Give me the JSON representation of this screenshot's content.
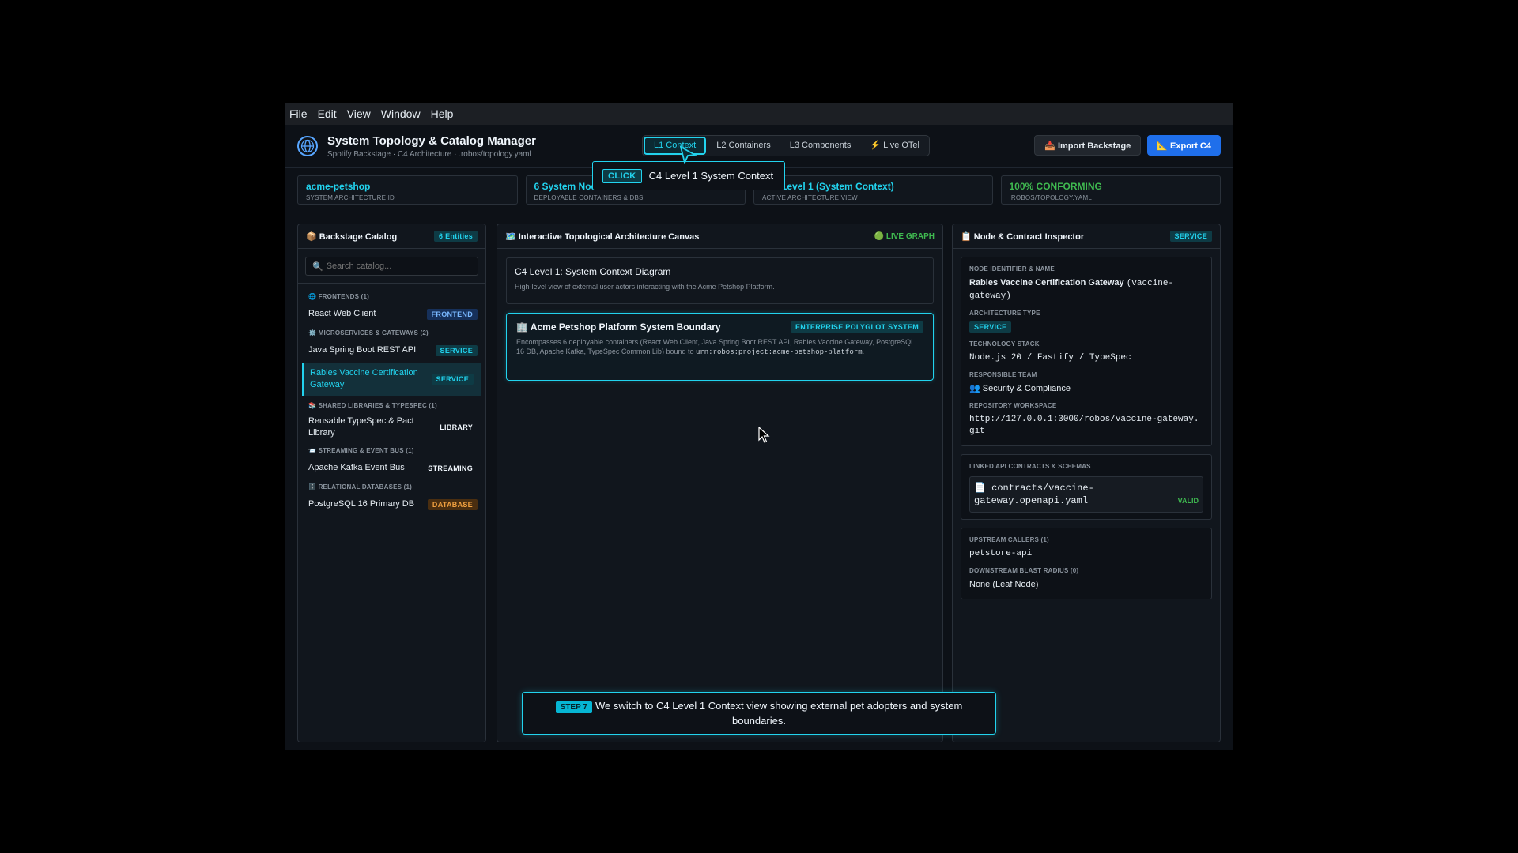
{
  "menu": [
    "File",
    "Edit",
    "View",
    "Window",
    "Help"
  ],
  "header": {
    "title": "System Topology & Catalog Manager",
    "subtitle": "Spotify Backstage · C4 Architecture · .robos/topology.yaml",
    "tabs": [
      "L1 Context",
      "L2 Containers",
      "L3 Components",
      "⚡ Live OTel"
    ],
    "import_label": "📥 Import Backstage",
    "export_label": "📐 Export C4"
  },
  "stats": [
    {
      "value": "acme-petshop",
      "label": "SYSTEM ARCHITECTURE ID"
    },
    {
      "value": "6 System Nodes",
      "label": "DEPLOYABLE CONTAINERS & DBS"
    },
    {
      "value": "Level 1 (System Context)",
      "label": "ACTIVE ARCHITECTURE VIEW"
    },
    {
      "value": "100% CONFORMING",
      "label": ".ROBOS/TOPOLOGY.YAML"
    }
  ],
  "tooltip": {
    "tag": "CLICK",
    "text": "C4 Level 1 System Context"
  },
  "catalog": {
    "title": "📦 Backstage Catalog",
    "count": "6 Entities",
    "search_placeholder": "Search catalog...",
    "groups": [
      {
        "name": "🌐 FRONTENDS (1)",
        "items": [
          {
            "name": "React Web Client",
            "kind": "FRONTEND"
          }
        ]
      },
      {
        "name": "⚙️ MICROSERVICES & GATEWAYS (2)",
        "items": [
          {
            "name": "Java Spring Boot REST API",
            "kind": "SERVICE"
          },
          {
            "name": "Rabies Vaccine Certification Gateway",
            "kind": "SERVICE"
          }
        ]
      },
      {
        "name": "📚 SHARED LIBRARIES & TYPESPEC (1)",
        "items": [
          {
            "name": "Reusable TypeSpec & Pact Library",
            "kind": "LIBRARY"
          }
        ]
      },
      {
        "name": "📨 STREAMING & EVENT BUS (1)",
        "items": [
          {
            "name": "Apache Kafka Event Bus",
            "kind": "STREAMING"
          }
        ]
      },
      {
        "name": "🗄️ RELATIONAL DATABASES (1)",
        "items": [
          {
            "name": "PostgreSQL 16 Primary DB",
            "kind": "DATABASE"
          }
        ]
      }
    ]
  },
  "canvas": {
    "title": "🗺️ Interactive Topological Architecture Canvas",
    "status": "🟢 LIVE GRAPH",
    "diagram_title": "C4 Level 1: System Context Diagram",
    "diagram_desc": "High-level view of external user actors interacting with the Acme Petshop Platform.",
    "boundary_title": "🏢 Acme Petshop Platform System Boundary",
    "boundary_badge": "ENTERPRISE POLYGLOT SYSTEM",
    "boundary_desc": "Encompasses 6 deployable containers (React Web Client, Java Spring Boot REST API, Rabies Vaccine Gateway, PostgreSQL 16 DB, Apache Kafka, TypeSpec Common Lib) bound to ",
    "boundary_urn": "urn:robos:project:acme-petshop-platform",
    "boundary_end": "."
  },
  "inspector": {
    "title": "📋 Node & Contract Inspector",
    "badge": "SERVICE",
    "node_label": "NODE IDENTIFIER & NAME",
    "node_name": "Rabies Vaccine Certification Gateway",
    "node_id": "(vaccine-gateway)",
    "arch_label": "ARCHITECTURE TYPE",
    "arch_value": "SERVICE",
    "tech_label": "TECHNOLOGY STACK",
    "tech_value": "Node.js 20 / Fastify / TypeSpec",
    "team_label": "RESPONSIBLE TEAM",
    "team_value": "👥 Security & Compliance",
    "repo_label": "REPOSITORY WORKSPACE",
    "repo_value": "http://127.0.0.1:3000/robos/vaccine-gateway.git",
    "contracts_label": "LINKED API CONTRACTS & SCHEMAS",
    "contract_file": "📄 contracts/vaccine-gateway.openapi.yaml",
    "contract_status": "VALID",
    "upstream_label": "UPSTREAM CALLERS (1)",
    "upstream_value": "petstore-api",
    "downstream_label": "DOWNSTREAM BLAST RADIUS (0)",
    "downstream_value": "None (Leaf Node)"
  },
  "step": {
    "tag": "STEP 7",
    "text": "We switch to C4 Level 1 Context view showing external pet adopters and system boundaries."
  },
  "colors": {
    "accent": "#22d3ee",
    "primary": "#1f6feb",
    "success": "#3fb950",
    "background": "#0d1117"
  }
}
